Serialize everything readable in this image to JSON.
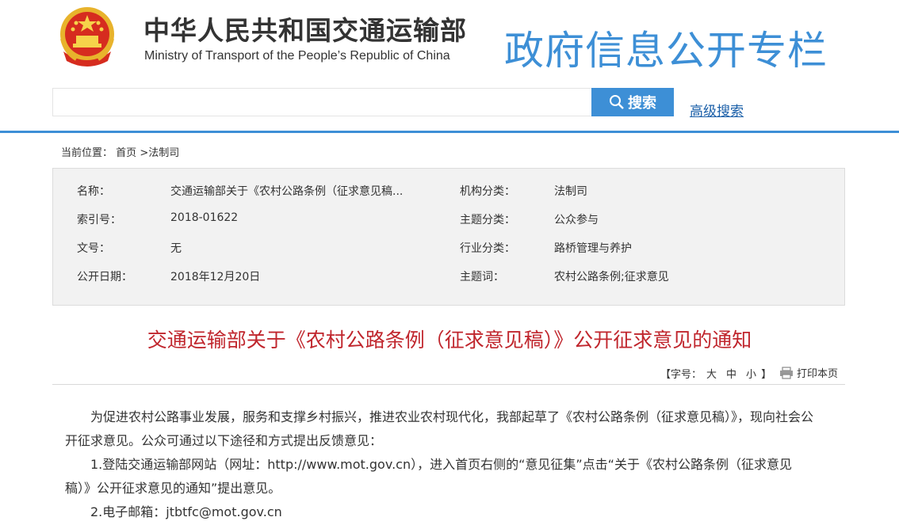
{
  "header": {
    "title_cn": "中华人民共和国交通运输部",
    "title_en": "Ministry of Transport of the People’s Republic of China",
    "column_title": "政府信息公开专栏"
  },
  "search": {
    "placeholder": "",
    "button_label": "搜索",
    "advanced_label": "高级搜索"
  },
  "breadcrumb": {
    "prefix": "当前位置：",
    "home": "首页",
    "current": ">法制司"
  },
  "info": {
    "rows": [
      {
        "label": "名称：",
        "value": "交通运输部关于《农村公路条例（征求意见稿...",
        "label2": "机构分类：",
        "value2": "法制司"
      },
      {
        "label": "索引号：",
        "value": "2018-01622",
        "label2": "主题分类：",
        "value2": "公众参与"
      },
      {
        "label": "文号：",
        "value": "无",
        "label2": "行业分类：",
        "value2": "路桥管理与养护"
      },
      {
        "label": "公开日期：",
        "value": "2018年12月20日",
        "label2": "主题词：",
        "value2": "农村公路条例;征求意见"
      }
    ]
  },
  "document": {
    "title": "交通运输部关于《农村公路条例（征求意见稿）》公开征求意见的通知",
    "font_label_open": "【字号：",
    "size_large": "大",
    "size_medium": "中",
    "size_small": "小",
    "font_label_close": "】",
    "print_label": "打印本页",
    "paragraphs": [
      "　　为促进农村公路事业发展，服务和支撑乡村振兴，推进农业农村现代化，我部起草了《农村公路条例（征求意见稿）》，现向社会公",
      "开征求意见。公众可通过以下途径和方式提出反馈意见：",
      "　　1.登陆交通运输部网站（网址：http://www.mot.gov.cn），进入首页右侧的“意见征集”点击“关于《农村公路条例（征求意见",
      "稿）》公开征求意见的通知”提出意见。",
      "　　2.电子邮箱：jtbtfc@mot.gov.cn"
    ]
  },
  "colors": {
    "accent": "#3d8fd6",
    "title_red": "#c0262d",
    "link": "#1a5fa8"
  },
  "icons": [
    "national-emblem-icon",
    "search-icon",
    "printer-icon"
  ]
}
